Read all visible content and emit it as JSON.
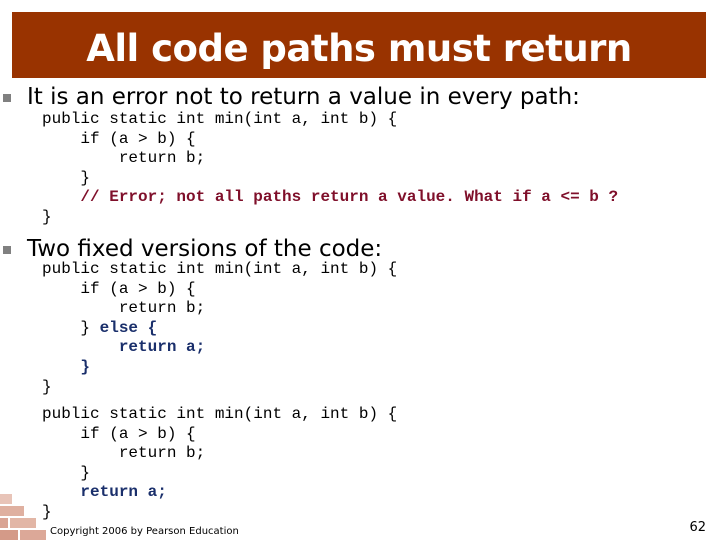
{
  "slide": {
    "title": "All code paths must return",
    "bullets": [
      {
        "text": "It is an error not to return a value in every path:",
        "code": [
          {
            "text": "public static int min(int a, int b) {",
            "style": "normal"
          },
          {
            "text": "    if (a > b) {",
            "style": "normal"
          },
          {
            "text": "        return b;",
            "style": "normal"
          },
          {
            "text": "    }",
            "style": "normal"
          },
          {
            "text": "    // Error; not all paths return a value. What if a <= b ?",
            "style": "error"
          },
          {
            "text": "}",
            "style": "normal"
          }
        ]
      },
      {
        "text": "Two fixed versions of the code:",
        "code_versions": [
          [
            {
              "text": "public static int min(int a, int b) {",
              "style": "normal"
            },
            {
              "text": "    if (a > b) {",
              "style": "normal"
            },
            {
              "text": "        return b;",
              "style": "normal"
            },
            {
              "text": "    } ",
              "style": "normal",
              "suffix": "else {",
              "suffix_style": "fix"
            },
            {
              "text": "        return a;",
              "style": "fix"
            },
            {
              "text": "    }",
              "style": "fix"
            },
            {
              "text": "}",
              "style": "normal"
            }
          ],
          [
            {
              "text": "public static int min(int a, int b) {",
              "style": "normal"
            },
            {
              "text": "    if (a > b) {",
              "style": "normal"
            },
            {
              "text": "        return b;",
              "style": "normal"
            },
            {
              "text": "    }",
              "style": "normal"
            },
            {
              "text": "    return a;",
              "style": "fix"
            },
            {
              "text": "}",
              "style": "normal"
            }
          ]
        ]
      }
    ],
    "footer": "Copyright 2006 by Pearson Education",
    "page_number": "62",
    "colors": {
      "title_bar": "#993300",
      "title_text": "#ffffff",
      "error_comment": "#7f0f2a",
      "fix_code": "#1a2f6b",
      "bullet_marker": "#808080"
    }
  }
}
